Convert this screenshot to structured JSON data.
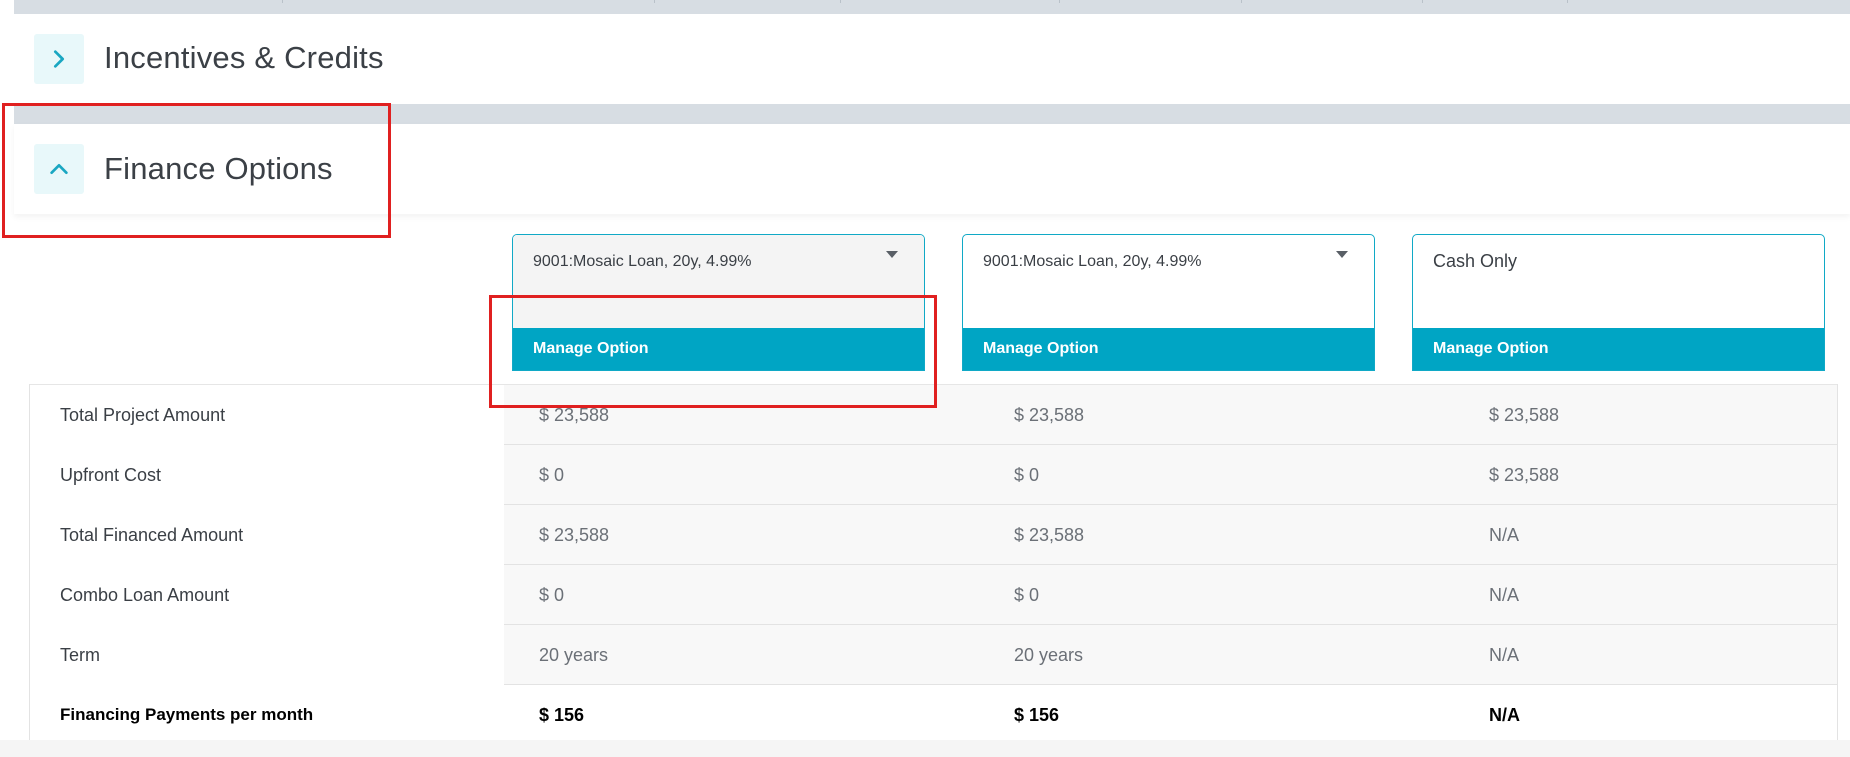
{
  "sections": {
    "incentives": {
      "title": "Incentives & Credits",
      "expanded": false
    },
    "finance": {
      "title": "Finance Options",
      "expanded": true
    }
  },
  "options": [
    {
      "selected": "9001:Mosaic Loan, 20y, 4.99%",
      "has_dropdown": true,
      "manage_label": "Manage Option"
    },
    {
      "selected": "9001:Mosaic Loan, 20y, 4.99%",
      "has_dropdown": true,
      "manage_label": "Manage Option"
    },
    {
      "selected": "Cash Only",
      "has_dropdown": false,
      "manage_label": "Manage Option"
    }
  ],
  "table": {
    "rows": [
      {
        "label": "Total Project Amount",
        "values": [
          "$ 23,588",
          "$ 23,588",
          "$ 23,588"
        ]
      },
      {
        "label": "Upfront Cost",
        "values": [
          "$ 0",
          "$ 0",
          "$ 23,588"
        ]
      },
      {
        "label": "Total Financed Amount",
        "values": [
          "$ 23,588",
          "$ 23,588",
          "N/A"
        ]
      },
      {
        "label": "Combo Loan Amount",
        "values": [
          "$ 0",
          "$ 0",
          "N/A"
        ]
      },
      {
        "label": "Term",
        "values": [
          "20 years",
          "20 years",
          "N/A"
        ]
      },
      {
        "label": "Financing Payments per month",
        "values": [
          "$ 156",
          "$ 156",
          "N/A"
        ]
      }
    ]
  },
  "colors": {
    "accent": "#00a5c4",
    "highlight": "#e02020",
    "chevron": "#1aa7c2"
  }
}
